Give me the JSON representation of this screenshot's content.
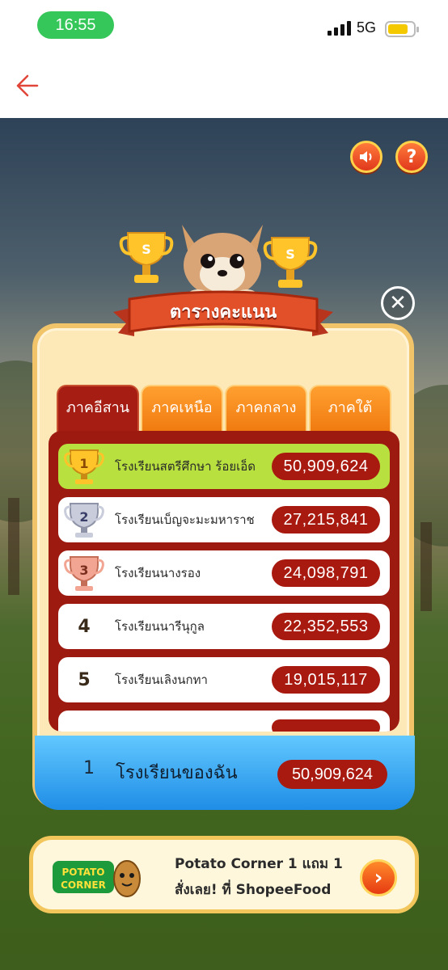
{
  "status_bar": {
    "time": "16:55",
    "network": "5G",
    "battery_color": "#f5c900",
    "time_pill_color": "#35c759"
  },
  "nav": {
    "back_icon": "arrow-left-icon"
  },
  "game": {
    "sound_icon": "speaker-icon",
    "help_label": "?",
    "close_label": "✕",
    "title": "ตารางคะแนน",
    "tabs": [
      {
        "label": "ภาคอีสาน",
        "active": true
      },
      {
        "label": "ภาคเหนือ",
        "active": false
      },
      {
        "label": "ภาคกลาง",
        "active": false
      },
      {
        "label": "ภาคใต้",
        "active": false
      }
    ],
    "leaderboard": [
      {
        "rank": "1",
        "school": "โรงเรียนสตรีศึกษา ร้อยเอ็ด",
        "score": "50,909,624",
        "medal": "gold"
      },
      {
        "rank": "2",
        "school": "โรงเรียนเบ็ญจะมะมหาราช",
        "score": "27,215,841",
        "medal": "silver"
      },
      {
        "rank": "3",
        "school": "โรงเรียนนางรอง",
        "score": "24,098,791",
        "medal": "bronze"
      },
      {
        "rank": "4",
        "school": "โรงเรียนนารีนุกูล",
        "score": "22,352,553",
        "medal": "none"
      },
      {
        "rank": "5",
        "school": "โรงเรียนเลิงนกทา",
        "score": "19,015,117",
        "medal": "none"
      }
    ],
    "my_school": {
      "rank": "1",
      "name": "โรงเรียนของฉัน",
      "score": "50,909,624"
    },
    "ad": {
      "logo_text_1": "POTATO",
      "logo_text_2": "CORNER",
      "line1": "Potato Corner 1 แถม 1",
      "line2": "สั่งเลย! ที่ ShopeeFood",
      "arrow_label": "›"
    },
    "colors": {
      "accent_red": "#a51d13",
      "tab_orange": "#f07a10",
      "first_row_green": "#b8e03e",
      "my_bar_blue": "#1f8de6"
    }
  }
}
